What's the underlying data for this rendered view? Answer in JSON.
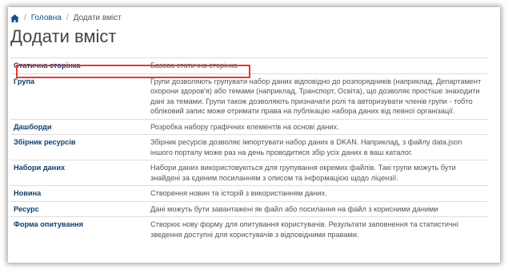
{
  "breadcrumb": {
    "home_icon": "home-icon",
    "items": [
      "Головна",
      "Додати вміст"
    ]
  },
  "page_title": "Додати вміст",
  "content_types": [
    {
      "name": "Статична сторінка",
      "description": "Базова статична сторінка"
    },
    {
      "name": "Група",
      "description": "Групи дозволяють групувати набор даних відповідно до розпорядників (наприклад, Департамент охорони здоров'я) або темами (наприклад, Транспорт, Освіта), що дозволяє простіше знаходити дані за темами. Групи також дозволяють призначати ролі та авторизувати членів групи - тобто обліковий запис може отримати права на публікацію набора даних від певної організації."
    },
    {
      "name": "Дашборди",
      "description": "Розробка набору графічних елементів на основі даних."
    },
    {
      "name": "Збірник ресурсів",
      "description": "Збірник ресурсів дозволяє імпортувати набор даних в DKAN. Наприклад, з файлу data.json іншого порталу може раз на день проводитися збір усіх даних в ваш каталог."
    },
    {
      "name": "Набори даних",
      "description": "Набори даних використовуються для групування окремих файлів. Такі групи можуть бути знайдені за єдиним посиланням з описом та інформацією щодо ліцензії."
    },
    {
      "name": "Новина",
      "description": "Створення новин та історій з використанням даних."
    },
    {
      "name": "Ресурс",
      "description": "Дані можуть бути завантажені як файл або посилання на файл з корисними даними"
    },
    {
      "name": "Форма опитування",
      "description": "Створює нову форму для опитування користувачів. Результати заповнення та статистичні зведення доступні для користувачів з відповідними правами."
    }
  ],
  "colors": {
    "link": "#0d3f6e",
    "highlight": "#e53935"
  }
}
